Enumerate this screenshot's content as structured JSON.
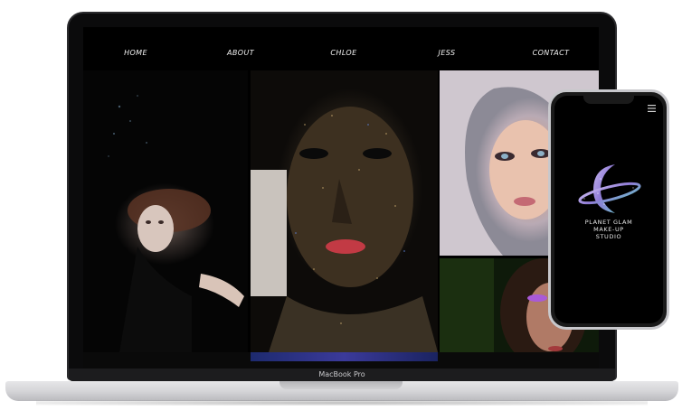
{
  "nav": {
    "items": [
      {
        "label": "HOME"
      },
      {
        "label": "ABOUT"
      },
      {
        "label": "CHLOE"
      },
      {
        "label": "JESS"
      },
      {
        "label": "CONTACT"
      }
    ]
  },
  "laptop": {
    "brand_label": "MacBook Pro"
  },
  "phone": {
    "menu_icon": "hamburger-icon",
    "studio_lines": [
      "PLANET GLAM",
      "MAKE-UP",
      "STUDIO"
    ]
  },
  "colors": {
    "screen_bg": "#000000",
    "nav_text": "#f2f2f2",
    "accent_glitter": "#8f7bd6"
  }
}
